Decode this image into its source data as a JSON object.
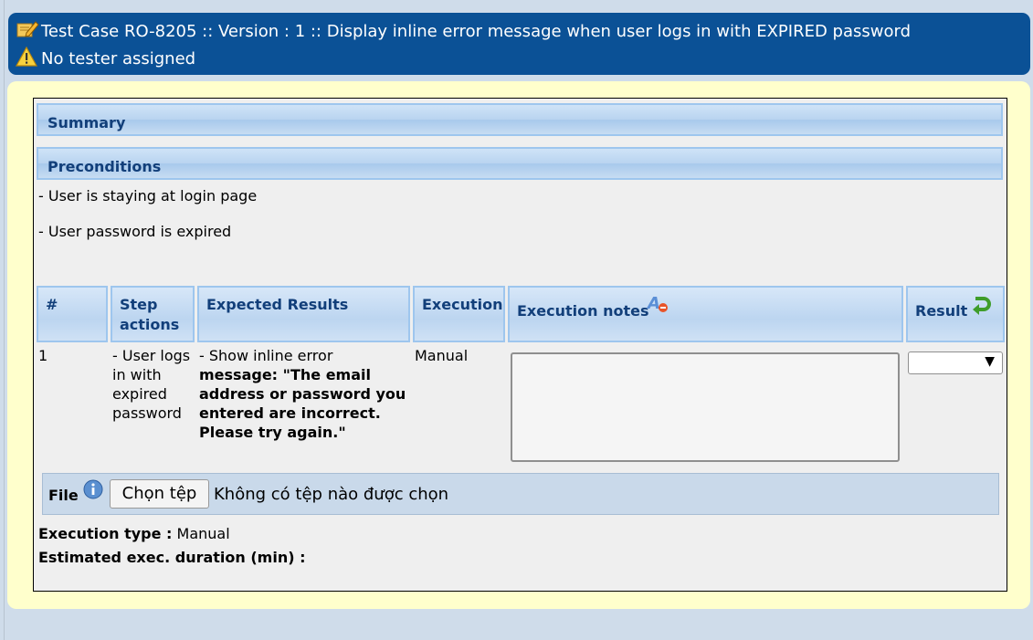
{
  "header": {
    "title": "Test Case RO-8205 :: Version : 1 :: Display inline error message when user logs in with EXPIRED password",
    "tester": "No tester assigned"
  },
  "sections": {
    "summary": "Summary",
    "preconditions": "Preconditions"
  },
  "preconditions": [
    "- User is staying at login page",
    "- User password is expired"
  ],
  "steps_table": {
    "headers": {
      "num": "#",
      "step_actions_l1": "Step",
      "step_actions_l2": "actions",
      "expected_results": "Expected Results",
      "execution": "Execution",
      "execution_notes": "Execution notes",
      "result": "Result"
    },
    "rows": [
      {
        "num": "1",
        "action_lines": [
          "- User logs",
          "in with",
          "expired",
          "password"
        ],
        "expected_first": "- Show inline error",
        "expected_bold_lines": [
          "message: \"The email",
          "address or password you",
          "entered are incorrect.",
          "Please try again.\""
        ],
        "execution": "Manual"
      }
    ]
  },
  "result_select": {
    "selected": ""
  },
  "file": {
    "label": "File",
    "button": "Chọn tệp",
    "status": "Không có tệp nào được chọn"
  },
  "execution_type": {
    "label": "Execution type :",
    "value": "Manual"
  },
  "estimated_duration": {
    "label": "Estimated exec. duration (min) :"
  },
  "colors": {
    "header_bg": "#0b5196",
    "section_text": "#123f7a",
    "outer_bg": "#ffffcc"
  }
}
